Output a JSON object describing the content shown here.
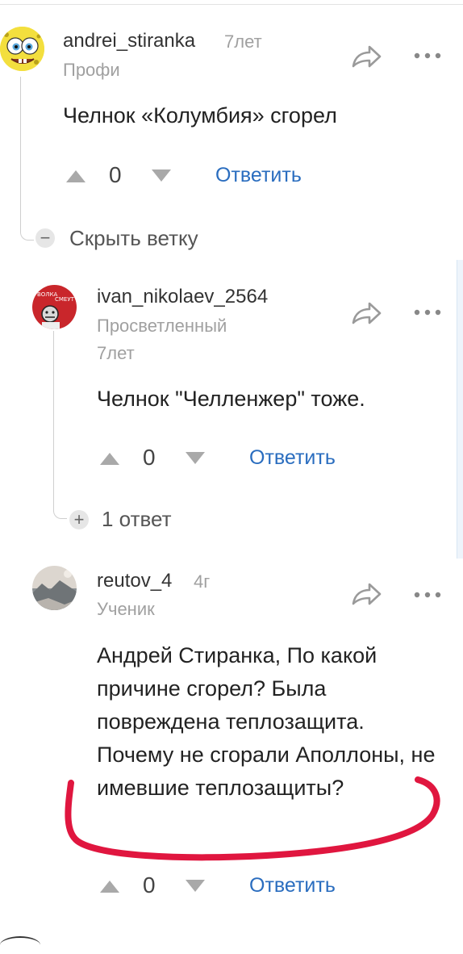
{
  "comments": [
    {
      "author": "andrei_stiranka",
      "time": "7лет",
      "rank": "Профи",
      "text": "Челнок «Колумбия» сгорел",
      "score": "0",
      "reply_label": "Ответить",
      "avatar_icon": "spongebob-avatar"
    },
    {
      "author": "ivan_nikolaev_2564",
      "time": "7лет",
      "rank": "Просветленный",
      "text": "Челнок \"Челленжер\" тоже.",
      "score": "0",
      "reply_label": "Ответить",
      "avatar_icon": "red-poster-avatar"
    },
    {
      "author": "reutov_4",
      "time": "4г",
      "rank": "Ученик",
      "text": "Андрей Стиранка, По какой причине сгорел? Была повреждена теплозащита. Почему не сгорали Аполлоны, не имевшие теплозащиты?",
      "score": "0",
      "reply_label": "Ответить",
      "avatar_icon": "landscape-avatar"
    }
  ],
  "hide_branch_label": "Скрыть ветку",
  "replies_label": "1 ответ",
  "colors": {
    "link": "#2a6dbf",
    "annotation": "#e0163f",
    "muted": "#a0a0a0"
  }
}
